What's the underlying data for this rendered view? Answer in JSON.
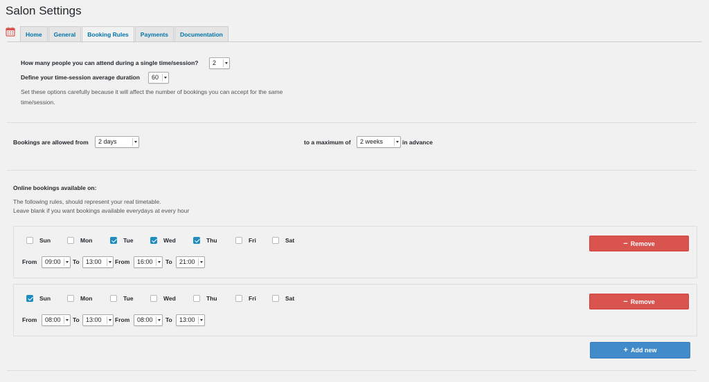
{
  "page": {
    "title": "Salon Settings"
  },
  "tabs": [
    "Home",
    "General",
    "Booking Rules",
    "Payments",
    "Documentation"
  ],
  "active_tab": "Booking Rules",
  "session": {
    "people_label": "How many people you can attend during a single time/session?",
    "people_value": "2",
    "duration_label": "Define your time-session average duration",
    "duration_value": "60",
    "note": "Set these options carefully because it will affect the number of bookings you can accept for the same time/session."
  },
  "advance": {
    "from_label": "Bookings are allowed from",
    "from_value": "2 days",
    "max_label": "to a maximum of",
    "max_value": "2 weeks",
    "suffix": "in advance"
  },
  "online": {
    "title": "Online bookings available on:",
    "desc1": "The following rules, should represent your real timetable.",
    "desc2": "Leave blank if you want bookings available everydays at every hour"
  },
  "days": [
    "Sun",
    "Mon",
    "Tue",
    "Wed",
    "Thu",
    "Fri",
    "Sat"
  ],
  "labels": {
    "from": "From",
    "to": "To",
    "remove": "Remove",
    "add_new": "Add new"
  },
  "rules": [
    {
      "checked": [
        false,
        false,
        true,
        true,
        true,
        false,
        false
      ],
      "times": [
        "09:00",
        "13:00",
        "16:00",
        "21:00"
      ]
    },
    {
      "checked": [
        true,
        false,
        false,
        false,
        false,
        false,
        false
      ],
      "times": [
        "08:00",
        "13:00",
        "08:00",
        "13:00"
      ]
    }
  ],
  "colors": {
    "remove": "#d9534f",
    "add": "#428bca",
    "check": "#1e8cbe",
    "calendar_icon": "#d9534f"
  }
}
